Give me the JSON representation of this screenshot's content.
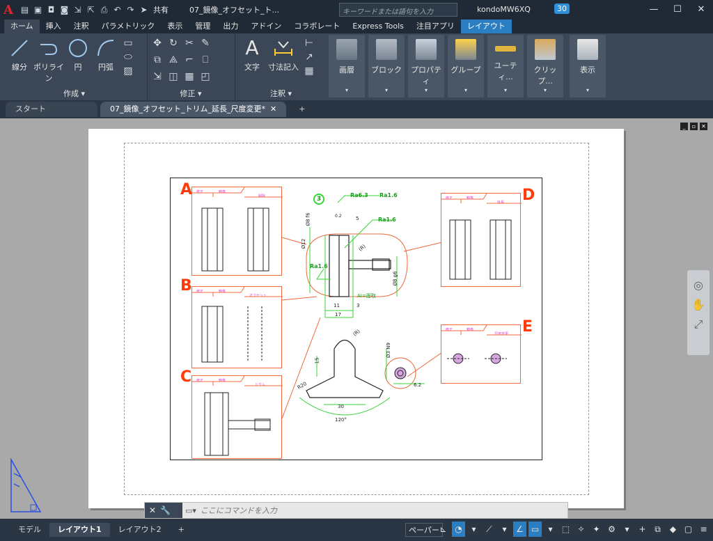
{
  "app": {
    "logo": "A",
    "share": "共有",
    "doc_title": "07_鏡像_オフセット_ト..."
  },
  "search": {
    "placeholder": "キーワードまたは語句を入力"
  },
  "user": {
    "name": "kondoMW6XQ",
    "timer_badge": "30"
  },
  "ribbon_tabs": [
    "ホーム",
    "挿入",
    "注釈",
    "パラメトリック",
    "表示",
    "管理",
    "出力",
    "アドイン",
    "コラボレート",
    "Express Tools",
    "注目アプリ",
    "レイアウト"
  ],
  "ribbon": {
    "draw": {
      "line": "線分",
      "polyline": "ポリライン",
      "circle": "円",
      "arc": "円弧",
      "footer": "作成"
    },
    "modify": {
      "footer": "修正"
    },
    "annotation": {
      "text": "文字",
      "dimension": "寸法記入",
      "footer": "注釈"
    },
    "groups": [
      "画層",
      "ブロック",
      "プロパティ",
      "グループ",
      "ユーティ...",
      "クリップ...",
      "表示"
    ]
  },
  "doc_tabs": {
    "start": "スタート",
    "active": "07_鏡像_オフセット_トリム_延長_尺度変更*",
    "close": "✕",
    "add": "+"
  },
  "drawing": {
    "letters": [
      "A",
      "B",
      "C",
      "D",
      "E"
    ],
    "boxes": {
      "a": {
        "col1": "修正",
        "col2": "鏡像",
        "col3": "削除"
      },
      "b": {
        "col1": "修正",
        "col2": "鏡像",
        "col3": "オフセット"
      },
      "c": {
        "col1": "修正",
        "col2": "鏡像",
        "col3": "トリム"
      },
      "d": {
        "col1": "修正",
        "col2": "鏡像",
        "col3": "延長"
      },
      "e": {
        "col1": "修正",
        "col2": "鏡像",
        "col3": "尺度変更"
      }
    },
    "annotations": {
      "circled_number": "3",
      "ra_top": "Ra6.3",
      "ra_paren": "Ra1.6",
      "ra_mid": "Ra1.6",
      "ra_left": "Ra1.6",
      "dim_phi8": "Ø8 f6",
      "dim_phi12": "Ø12",
      "dim_5": "5",
      "dim_r": "(R)",
      "dim_phi8g6": "Ø8 g6",
      "dim_11": "11",
      "dim_3": "3",
      "dim_17": "17",
      "dim_ai": "AI=面取",
      "dim_r_lower": "(R)",
      "dim_15": "15",
      "dim_r20": "R20",
      "dim_30": "30",
      "dim_120": "120°",
      "dim_phi3": "Ø3 N9",
      "dim_62": "6.2",
      "dim_small": "0.2"
    }
  },
  "command": {
    "placeholder": "ここにコマンドを入力"
  },
  "layout_tabs": [
    "モデル",
    "レイアウト1",
    "レイアウト2"
  ],
  "status": {
    "paper": "ペーパー"
  }
}
